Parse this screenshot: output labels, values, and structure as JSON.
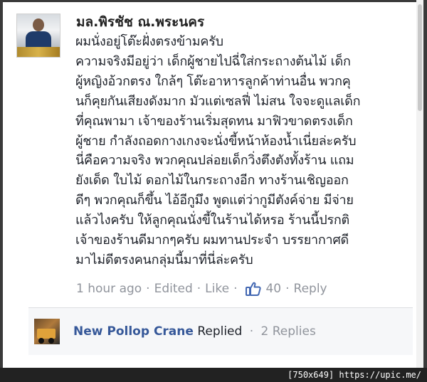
{
  "comment": {
    "author": "มล.พิรชัช ณ.พระนคร",
    "lines": [
      "ผมนั่งอยู่โต๊ะฝั่งตรงข้ามครับ",
      "ความจริงมีอยู่ว่า เด็กผู้ชายไปฉี่ใส่กระถางต้นไม้ เด็ก",
      "ผู้หญิงอ้วกตรง ใกล้ๆ โต๊ะอาหารลูกค้าท่านอื่น พวกคุ",
      "นก็คุยกันเสียงดังมาก มัวแต่เซลฟี่ ไม่สน ใจจะดูแลเด็ก",
      "ที่คุณพามา เจ้าของร้านเริ่มสุดทน มาฟิวขาดตรงเด็ก",
      "ผู้ชาย กำลังถอดกางเกงจะนั่งขี้หน้าห้องน้ำเนี่ยล่ะครับ",
      "นี่คือความจริง พวกคุณปล่อยเด็กวิ่งตึงตังทั้งร้าน แถม",
      "ยังเด็ด ใบไม้ ดอกไม้ในกระถางอีก ทางร้านเชิญออก",
      "ดีๆ พวกคุณก็ขึ้น ไอ้อีกูมึง พูดแต่ว่ากูมีตังค์จ่าย มีจ่าย",
      "แล้วไงครับ ให้ลูกคุณนั่งขี้ในร้านได้หรอ ร้านนี้ปรกติ",
      "เจ้าของร้านดีมากๆครับ ผมทานประจำ บรรยากาศดี",
      "มาไม่ดีตรงคนกลุ่มนี้มาที่นี่ล่ะครับ"
    ],
    "time": "1 hour ago",
    "edited": "Edited",
    "like": "Like",
    "like_count": "40",
    "reply": "Reply",
    "dot": "·"
  },
  "reply": {
    "author": "New Pollop Crane",
    "action": "Replied",
    "dot": "·",
    "replies": "2 Replies"
  },
  "watermark": "[750x649] https://upic.me/",
  "colors": {
    "meta": "#90949c",
    "link": "#365899",
    "like_icon": "#4267b2"
  }
}
